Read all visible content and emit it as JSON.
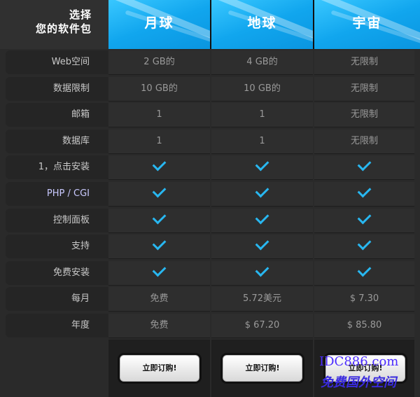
{
  "header": {
    "choose_line1": "选择",
    "choose_line2": "您的软件包",
    "plans": [
      "月球",
      "地球",
      "宇宙"
    ]
  },
  "rows": [
    {
      "label": "Web空间",
      "values": [
        "2 GB的",
        "4 GB的",
        "无限制"
      ]
    },
    {
      "label": "数据限制",
      "values": [
        "10 GB的",
        "10 GB的",
        "无限制"
      ]
    },
    {
      "label": "邮箱",
      "values": [
        "1",
        "1",
        "无限制"
      ]
    },
    {
      "label": "数据库",
      "values": [
        "1",
        "1",
        "无限制"
      ]
    },
    {
      "label": "1，点击安装",
      "values": [
        "check",
        "check",
        "check"
      ]
    },
    {
      "label": "PHP / CGI",
      "values": [
        "check",
        "check",
        "check"
      ]
    },
    {
      "label": "控制面板",
      "values": [
        "check",
        "check",
        "check"
      ]
    },
    {
      "label": "支持",
      "values": [
        "check",
        "check",
        "check"
      ]
    },
    {
      "label": "免费安装",
      "values": [
        "check",
        "check",
        "check"
      ]
    },
    {
      "label": "每月",
      "values": [
        "免费",
        "5.72美元",
        "$ 7.30"
      ]
    },
    {
      "label": "年度",
      "values": [
        "免费",
        "$ 67.20",
        "$ 85.80"
      ]
    }
  ],
  "buttons": {
    "order_label": "立即订购!"
  },
  "watermark": {
    "line1": "IDC886.com",
    "line2": "免费国外空间"
  },
  "colors": {
    "header_blue": "#11a6ee",
    "check_blue": "#28b7f0"
  }
}
